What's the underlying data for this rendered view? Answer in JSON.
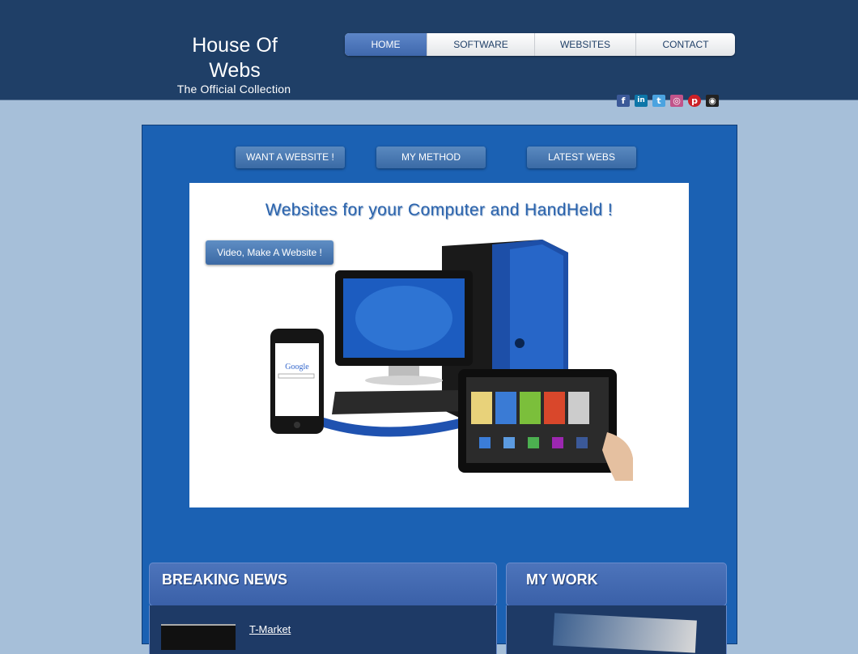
{
  "header": {
    "logo_title": "House Of Webs",
    "logo_subtitle": "The Official Collection"
  },
  "nav": {
    "items": [
      {
        "label": "HOME",
        "active": true
      },
      {
        "label": "SOFTWARE",
        "active": false
      },
      {
        "label": "WEBSITES",
        "active": false
      },
      {
        "label": "CONTACT",
        "active": false
      }
    ]
  },
  "social": {
    "icons": [
      {
        "name": "facebook-icon",
        "glyph": "f",
        "color": "#3b5998"
      },
      {
        "name": "linkedin-icon",
        "glyph": "in",
        "color": "#0e76a8"
      },
      {
        "name": "twitter-icon",
        "glyph": "t",
        "color": "#4ba3e0"
      },
      {
        "name": "instagram-icon",
        "glyph": "◎",
        "color": "#c1538a"
      },
      {
        "name": "pinterest-icon",
        "glyph": "p",
        "color": "#cb2027"
      },
      {
        "name": "github-icon",
        "glyph": "◉",
        "color": "#222222"
      }
    ]
  },
  "buttons": {
    "want_website": "WANT A WEBSITE !",
    "my_method": "MY METHOD",
    "latest_webs": "LATEST WEBS"
  },
  "hero": {
    "title": "Websites for your Computer and HandHeld !",
    "video_button": "Video, Make A Website !",
    "phone_search_text": "Google"
  },
  "news": {
    "title": "BREAKING NEWS",
    "first_item": "T-Market"
  },
  "work": {
    "title": "MY WORK"
  },
  "colors": {
    "page_bg": "#a6bfd9",
    "header_bg": "#1f3f67",
    "content_bg": "#1b61b3",
    "accent": "#2a63ad"
  }
}
